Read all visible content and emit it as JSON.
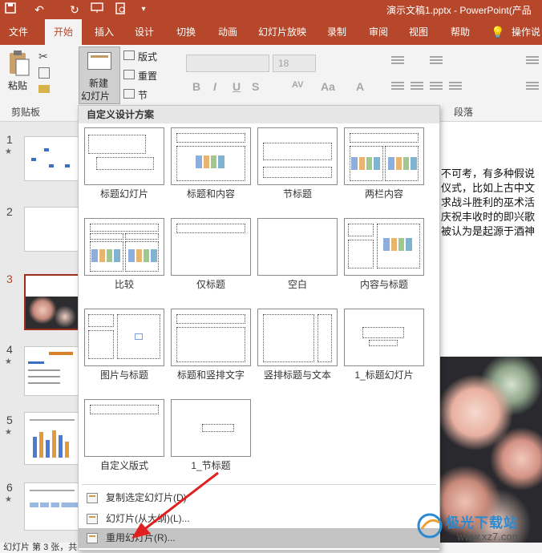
{
  "window": {
    "title": "演示文稿1.pptx  -  PowerPoint(产品"
  },
  "quick_access": {
    "save_icon": "save-icon",
    "undo_icon": "undo-icon",
    "redo_icon": "redo-icon",
    "more": "▾"
  },
  "tabs": [
    "文件",
    "开始",
    "插入",
    "设计",
    "切换",
    "动画",
    "幻灯片放映",
    "录制",
    "审阅",
    "视图",
    "帮助",
    "操作说"
  ],
  "active_tab": "开始",
  "ribbon": {
    "paste_label": "粘贴",
    "clipboard_group": "剪贴板",
    "new_slide_label_1": "新建",
    "new_slide_label_2": "幻灯片",
    "layout_label": "版式",
    "reset_label": "重置",
    "section_label": "节",
    "font_size": "18",
    "bold": "B",
    "italic": "I",
    "underline": "U",
    "strike": "S",
    "spacing": "AV",
    "case": "Aa",
    "font_color": "A",
    "paragraph_group": "段落"
  },
  "slides": [
    {
      "number": "1",
      "star": "★"
    },
    {
      "number": "2",
      "star": ""
    },
    {
      "number": "3",
      "star": ""
    },
    {
      "number": "4",
      "star": "★"
    },
    {
      "number": "5",
      "star": "★"
    },
    {
      "number": "6",
      "star": "★"
    }
  ],
  "selected_slide": "3",
  "editor_text": [
    "不可考，有多种假说",
    "仪式，比如上古中文",
    "求战斗胜利的巫术活",
    "庆祝丰收时的即兴歌",
    "被认为是起源于酒神"
  ],
  "status_bar": "幻灯片 第 3 张，共",
  "dropdown": {
    "header": "自定义设计方案",
    "layouts": [
      "标题幻灯片",
      "标题和内容",
      "节标题",
      "两栏内容",
      "比较",
      "仅标题",
      "空白",
      "内容与标题",
      "图片与标题",
      "标题和竖排文字",
      "竖排标题与文本",
      "1_标题幻灯片",
      "自定义版式",
      "1_节标题"
    ],
    "menu": [
      {
        "label": "复制选定幻灯片(D)",
        "icon": "duplicate-slide-icon"
      },
      {
        "label": "幻灯片(从大纲)(L)...",
        "icon": "outline-icon"
      },
      {
        "label": "重用幻灯片(R)...",
        "icon": "reuse-slide-icon"
      }
    ],
    "highlighted": "重用幻灯片(R)..."
  },
  "watermark": {
    "text": "极光下载站",
    "url": "www.xz7.com"
  },
  "colors": {
    "accent": "#b7472a",
    "selected_border": "#9b2d1e",
    "highlight": "#c4c4c4"
  }
}
